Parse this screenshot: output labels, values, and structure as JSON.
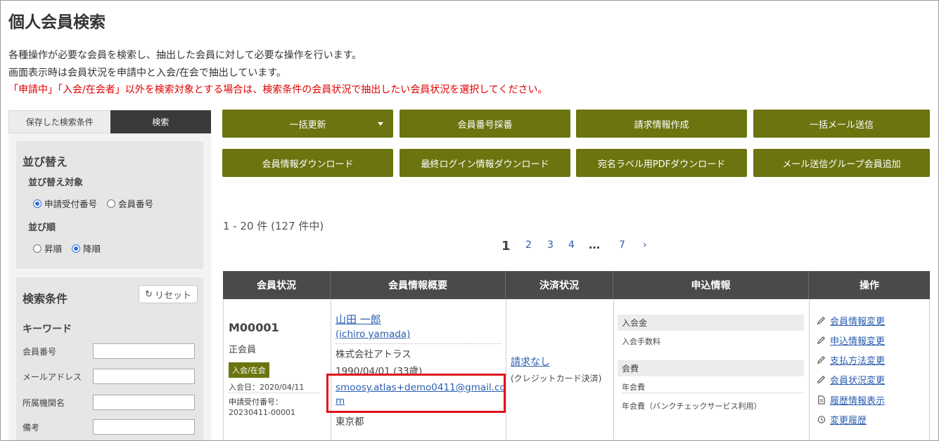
{
  "page": {
    "title": "個人会員検索",
    "desc1": "各種操作が必要な会員を検索し、抽出した会員に対して必要な操作を行います。",
    "desc2": "画面表示時は会員状況を申請中と入会/在会で抽出しています。",
    "desc3": "「申請中」「入会/在会者」以外を検索対象とする場合は、検索条件の会員状況で抽出したい会員状況を選択してください。"
  },
  "sidebar": {
    "tab_saved": "保存した検索条件",
    "tab_search": "検索",
    "sort_title": "並び替え",
    "sort_target_label": "並び替え対象",
    "sort_opt1": "申請受付番号",
    "sort_opt2": "会員番号",
    "order_label": "並び順",
    "order_asc": "昇順",
    "order_desc": "降順",
    "cond_title": "検索条件",
    "reset_label": "リセット",
    "keyword_label": "キーワード",
    "field_member_no": "会員番号",
    "field_email": "メールアドレス",
    "field_org": "所属機関名",
    "field_note": "備考"
  },
  "actions": {
    "bulk_update": "一括更新",
    "assign_number": "会員番号採番",
    "create_invoice": "請求情報作成",
    "bulk_mail": "一括メール送信",
    "download_member": "会員情報ダウンロード",
    "download_login": "最終ログイン情報ダウンロード",
    "download_label_pdf": "宛名ラベル用PDFダウンロード",
    "add_mail_group": "メール送信グループ会員追加"
  },
  "results": {
    "count_text": "1 - 20 件 (127 件中)",
    "pages": [
      "1",
      "2",
      "3",
      "4",
      "…",
      "7",
      "›"
    ]
  },
  "table": {
    "headers": [
      "会員状況",
      "会員情報概要",
      "決済状況",
      "申込情報",
      "操作"
    ],
    "row": {
      "member_no": "M00001",
      "member_type": "正会員",
      "status_tag": "入会/在会",
      "join_date": "入会日：2020/04/11",
      "app_no_label": "申請受付番号：",
      "app_no": "20230411-00001",
      "name": "山田 一郎",
      "name_roman": "(ichiro yamada)",
      "company": "株式会社アトラス",
      "birth": "1990/04/01 (33歳)",
      "email_line1": "smoosy.atlas+demo0411@gmail.co",
      "email_line2": "m",
      "prefecture": "東京都",
      "payment_status": "請求なし",
      "payment_method": "(クレジットカード決済)",
      "fee_group1": "入会金",
      "fee_item1": "入会手数料",
      "fee_group2": "会費",
      "fee_item2": "年会費",
      "fee_item3": "年会費（バンクチェックサービス利用）",
      "op1": "会員情報変更",
      "op2": "申込情報変更",
      "op3": "支払方法変更",
      "op4": "会員状況変更",
      "op5": "履歴情報表示",
      "op6": "変更履歴"
    }
  },
  "colors": {
    "button": "#6c7410",
    "header": "#4a4a4a",
    "highlight": "#e0141e",
    "warning": "#e00000"
  }
}
